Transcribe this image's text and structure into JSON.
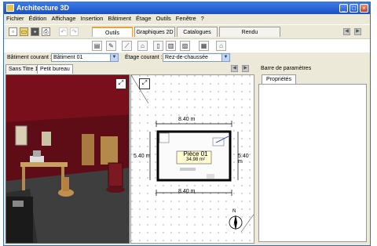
{
  "window": {
    "title": "Architecture 3D",
    "minimize": "_",
    "maximize": "□",
    "close": "×"
  },
  "menu": [
    "Fichier",
    "Édition",
    "Affichage",
    "Insertion",
    "Bâtiment",
    "Étage",
    "Outils",
    "Fenêtre",
    "?"
  ],
  "tabs": {
    "outils": "Outils",
    "graphiques2d": "Graphiques 2D",
    "catalogues": "Catalogues",
    "rendu": "Rendu"
  },
  "toolbar_icons": [
    "new-icon",
    "open-icon",
    "save-icon",
    "print-icon",
    "undo-icon",
    "redo-icon"
  ],
  "selectors": {
    "batiment_label": "Bâtiment courant :",
    "batiment_value": "Bâtiment 01",
    "etage_label": "Étage courant :",
    "etage_value": "Rez-de-chaussée"
  },
  "doc_tabs": {
    "tab1": "Sans Titre 1",
    "tab2": "Petit bureau"
  },
  "plan": {
    "width_top": "8.40 m",
    "width_bottom": "8.40 m",
    "height_left": "5.40 m",
    "height_right": "5.40 m",
    "room_name": "Pièce 01",
    "room_area": "34.98 m²"
  },
  "panel": {
    "title": "Barre de paramètres",
    "tab": "Propriétés"
  },
  "colors": {
    "titlebar": "#1b4fc3",
    "wall_3d": "#5a0d13",
    "floor_3d": "#3a3a3a",
    "accent_tab": "#e8a33c"
  }
}
